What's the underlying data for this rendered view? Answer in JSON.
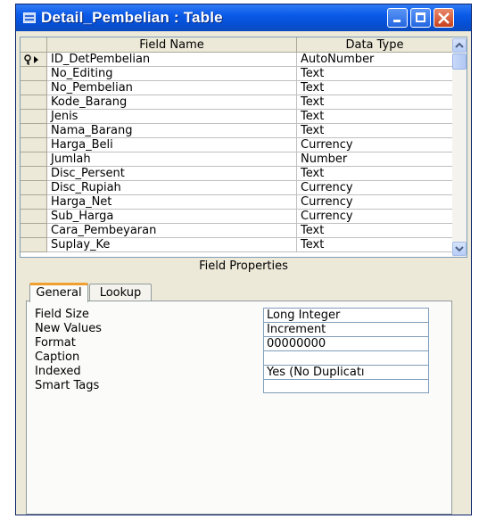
{
  "window": {
    "title": "Detail_Pembelian : Table"
  },
  "grid": {
    "headers": {
      "field_name": "Field Name",
      "data_type": "Data Type"
    },
    "rows": [
      {
        "field": "ID_DetPembelian",
        "type": "AutoNumber"
      },
      {
        "field": "No_Editing",
        "type": "Text"
      },
      {
        "field": "No_Pembelian",
        "type": "Text"
      },
      {
        "field": "Kode_Barang",
        "type": "Text"
      },
      {
        "field": "Jenis",
        "type": "Text"
      },
      {
        "field": "Nama_Barang",
        "type": "Text"
      },
      {
        "field": "Harga_Beli",
        "type": "Currency"
      },
      {
        "field": "Jumlah",
        "type": "Number"
      },
      {
        "field": "Disc_Persent",
        "type": "Text"
      },
      {
        "field": "Disc_Rupiah",
        "type": "Currency"
      },
      {
        "field": "Harga_Net",
        "type": "Currency"
      },
      {
        "field": "Sub_Harga",
        "type": "Currency"
      },
      {
        "field": "Cara_Pembeyaran",
        "type": "Text"
      },
      {
        "field": "Suplay_Ke",
        "type": "Text"
      }
    ]
  },
  "field_properties": {
    "title": "Field Properties",
    "tabs": [
      "General",
      "Lookup"
    ],
    "active_tab": "General",
    "properties": [
      {
        "label": "Field Size",
        "value": "Long Integer"
      },
      {
        "label": "New Values",
        "value": "Increment"
      },
      {
        "label": "Format",
        "value": "00000000"
      },
      {
        "label": "Caption",
        "value": ""
      },
      {
        "label": "Indexed",
        "value": "Yes (No Duplicatı"
      },
      {
        "label": "Smart Tags",
        "value": ""
      }
    ]
  },
  "icons": {
    "title": "table-icon",
    "primary_key": "key-icon",
    "current_row": "row-pointer-icon",
    "minimize": "minimize-icon",
    "maximize": "maximize-icon",
    "close": "close-icon"
  },
  "colors": {
    "titlebar": "#0a5ae8",
    "close_button": "#c8401c",
    "tab_highlight": "#f0a030"
  }
}
